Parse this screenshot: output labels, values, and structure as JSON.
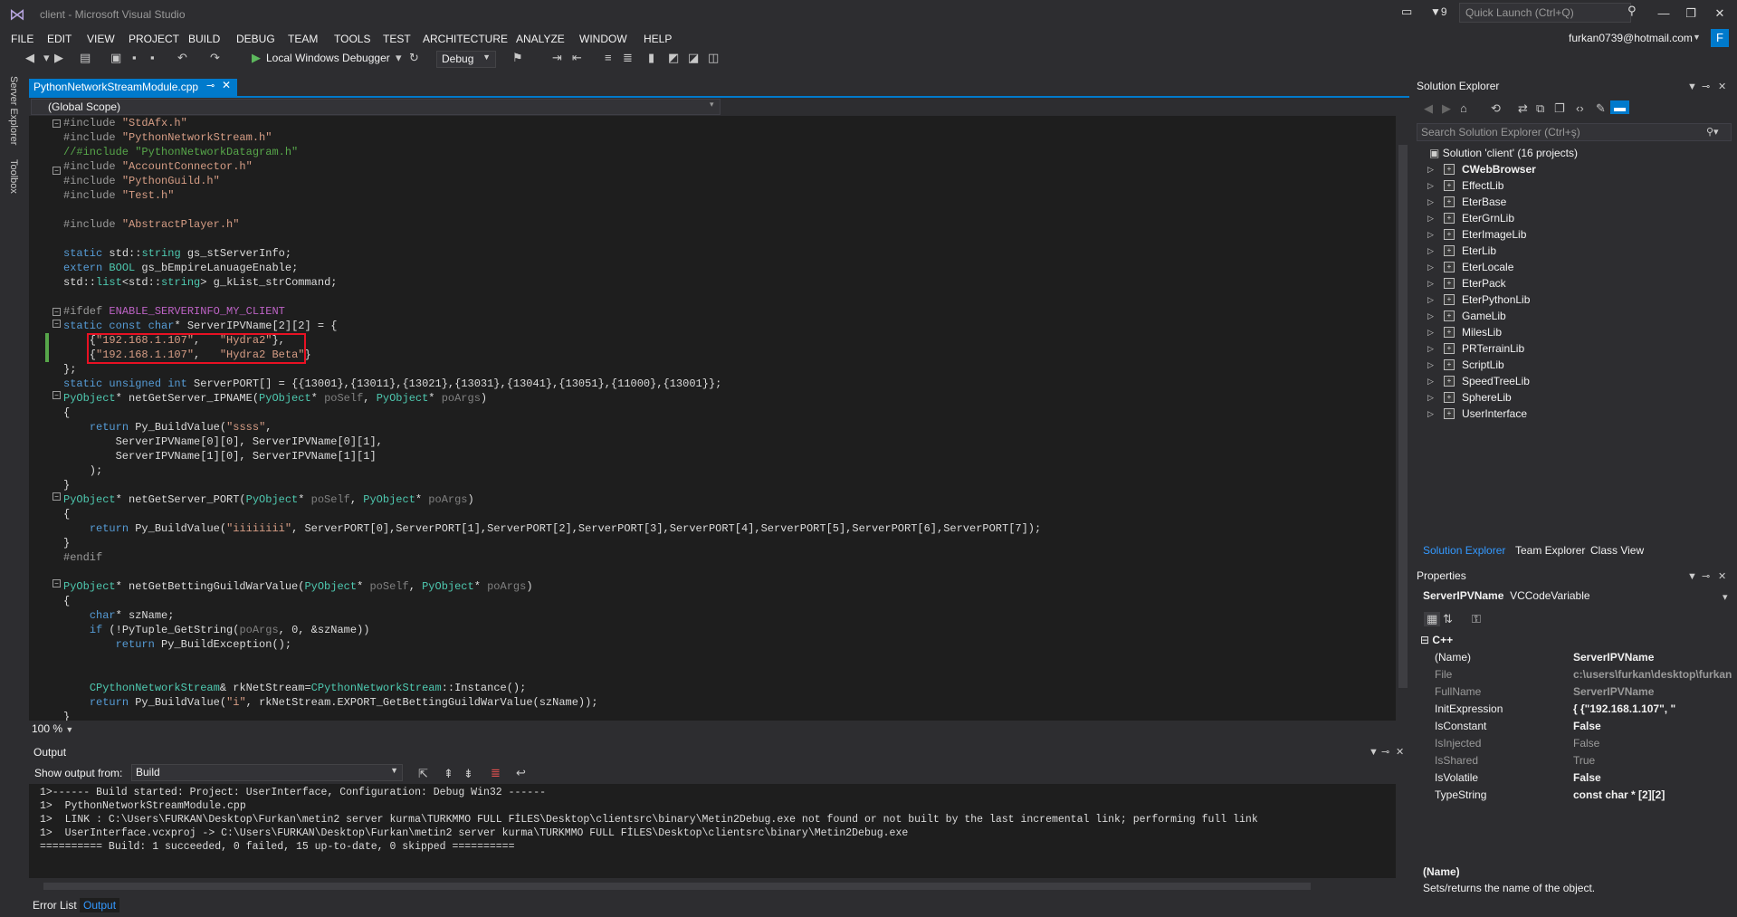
{
  "window": {
    "title": "client - Microsoft Visual Studio",
    "notification_count": "9",
    "quick_launch_placeholder": "Quick Launch (Ctrl+Q)",
    "account": "furkan0739@hotmail.com",
    "account_initial": "F"
  },
  "menu": [
    "FILE",
    "EDIT",
    "VIEW",
    "PROJECT",
    "BUILD",
    "DEBUG",
    "TEAM",
    "TOOLS",
    "TEST",
    "ARCHITECTURE",
    "ANALYZE",
    "WINDOW",
    "HELP"
  ],
  "toolbar": {
    "debugger_label": "Local Windows Debugger",
    "configuration": "Debug"
  },
  "left_rail": [
    "Server Explorer",
    "Toolbox"
  ],
  "editor": {
    "tab_label": "PythonNetworkStreamModule.cpp",
    "nav_scope": "(Global Scope)",
    "zoom": "100 %",
    "lines": [
      "#include \"StdAfx.h\"",
      "#include \"PythonNetworkStream.h\"",
      "//#include \"PythonNetworkDatagram.h\"",
      "#include \"AccountConnector.h\"",
      "#include \"PythonGuild.h\"",
      "#include \"Test.h\"",
      "",
      "#include \"AbstractPlayer.h\"",
      "",
      "static std::string gs_stServerInfo;",
      "extern BOOL gs_bEmpireLanuageEnable;",
      "std::list<std::string> g_kList_strCommand;",
      "",
      "#ifdef ENABLE_SERVERINFO_MY_CLIENT",
      "static const char* ServerIPVName[2][2] = {",
      "    {\"192.168.1.107\",   \"Hydra2\"},",
      "    {\"192.168.1.107\",   \"Hydra2 Beta\"}",
      "};",
      "static unsigned int ServerPORT[] = {{13001},{13011},{13021},{13031},{13041},{13051},{11000},{13001}};",
      "PyObject* netGetServer_IPNAME(PyObject* poSelf, PyObject* poArgs)",
      "{",
      "    return Py_BuildValue(\"ssss\",",
      "        ServerIPVName[0][0], ServerIPVName[0][1],",
      "        ServerIPVName[1][0], ServerIPVName[1][1]",
      "    );",
      "}",
      "PyObject* netGetServer_PORT(PyObject* poSelf, PyObject* poArgs)",
      "{",
      "    return Py_BuildValue(\"iiiiiiii\", ServerPORT[0],ServerPORT[1],ServerPORT[2],ServerPORT[3],ServerPORT[4],ServerPORT[5],ServerPORT[6],ServerPORT[7]);",
      "}",
      "#endif",
      "",
      "PyObject* netGetBettingGuildWarValue(PyObject* poSelf, PyObject* poArgs)",
      "{",
      "    char* szName;",
      "    if (!PyTuple_GetString(poArgs, 0, &szName))",
      "        return Py_BuildException();",
      "",
      "",
      "    CPythonNetworkStream& rkNetStream=CPythonNetworkStream::Instance();",
      "    return Py_BuildValue(\"i\", rkNetStream.EXPORT_GetBettingGuildWarValue(szName));",
      "}"
    ]
  },
  "output": {
    "title": "Output",
    "show_from_label": "Show output from:",
    "source": "Build",
    "lines": [
      "1>------ Build started: Project: UserInterface, Configuration: Debug Win32 ------",
      "1>  PythonNetworkStreamModule.cpp",
      "1>  LINK : C:\\Users\\FURKAN\\Desktop\\Furkan\\metin2 server kurma\\TURKMMO FULL FİLES\\Desktop\\clientsrc\\binary\\Metin2Debug.exe not found or not built by the last incremental link; performing full link",
      "1>  UserInterface.vcxproj -> C:\\Users\\FURKAN\\Desktop\\Furkan\\metin2 server kurma\\TURKMMO FULL FİLES\\Desktop\\clientsrc\\binary\\Metin2Debug.exe",
      "========== Build: 1 succeeded, 0 failed, 15 up-to-date, 0 skipped =========="
    ],
    "bottom_tabs": [
      "Error List",
      "Output"
    ]
  },
  "solution_explorer": {
    "title": "Solution Explorer",
    "search_placeholder": "Search Solution Explorer (Ctrl+ş)",
    "solution": "Solution 'client' (16 projects)",
    "projects": [
      "CWebBrowser",
      "EffectLib",
      "EterBase",
      "EterGrnLib",
      "EterImageLib",
      "EterLib",
      "EterLocale",
      "EterPack",
      "EterPythonLib",
      "GameLib",
      "MilesLib",
      "PRTerrainLib",
      "ScriptLib",
      "SpeedTreeLib",
      "SphereLib",
      "UserInterface"
    ],
    "tabs": [
      "Solution Explorer",
      "Team Explorer",
      "Class View"
    ]
  },
  "properties": {
    "title": "Properties",
    "object_name": "ServerIPVName",
    "object_type": "VCCodeVariable",
    "category": "C++",
    "rows": [
      {
        "name": "(Name)",
        "value": "ServerIPVName",
        "bold": true
      },
      {
        "name": "File",
        "value": "c:\\users\\furkan\\desktop\\furkan",
        "bold": true,
        "dim": true
      },
      {
        "name": "FullName",
        "value": "ServerIPVName",
        "bold": true,
        "dim": true
      },
      {
        "name": "InitExpression",
        "value": "{              {\"192.168.1.107\",   \"",
        "bold": true
      },
      {
        "name": "IsConstant",
        "value": "False",
        "bold": true
      },
      {
        "name": "IsInjected",
        "value": "False",
        "bold": false,
        "dim": true
      },
      {
        "name": "IsShared",
        "value": "True",
        "bold": false,
        "dim": true
      },
      {
        "name": "IsVolatile",
        "value": "False",
        "bold": true
      },
      {
        "name": "TypeString",
        "value": "const char * [2][2]",
        "bold": true
      }
    ],
    "desc_name": "(Name)",
    "desc_text": "Sets/returns the name of the object."
  }
}
